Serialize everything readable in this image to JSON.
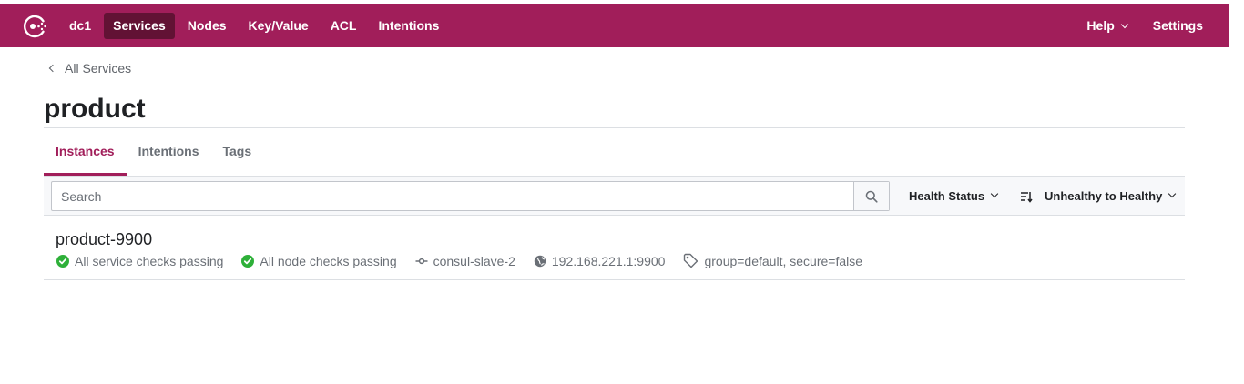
{
  "app": {
    "datacenter": "dc1",
    "brand_color": "#a11e5a",
    "icon": "consul-logo-icon"
  },
  "nav": {
    "items": [
      {
        "label": "Services",
        "active": true
      },
      {
        "label": "Nodes",
        "active": false
      },
      {
        "label": "Key/Value",
        "active": false
      },
      {
        "label": "ACL",
        "active": false
      },
      {
        "label": "Intentions",
        "active": false
      }
    ],
    "help_label": "Help",
    "settings_label": "Settings"
  },
  "breadcrumb": {
    "label": "All Services",
    "icon": "chevron-left-icon"
  },
  "page": {
    "title": "product"
  },
  "tabs": [
    {
      "label": "Instances",
      "active": true
    },
    {
      "label": "Intentions",
      "active": false
    },
    {
      "label": "Tags",
      "active": false
    }
  ],
  "toolbar": {
    "search_placeholder": "Search",
    "search_value": "",
    "search_icon": "search-icon",
    "health_filter_label": "Health Status",
    "sort_label": "Unhealthy to Healthy",
    "sort_icon": "sort-icon"
  },
  "instances": [
    {
      "name": "product-9900",
      "service_checks": "All service checks passing",
      "node_checks": "All node checks passing",
      "node": "consul-slave-2",
      "address": "192.168.221.1:9900",
      "tags": "group=default, secure=false",
      "status_color": "#2eb039"
    }
  ]
}
